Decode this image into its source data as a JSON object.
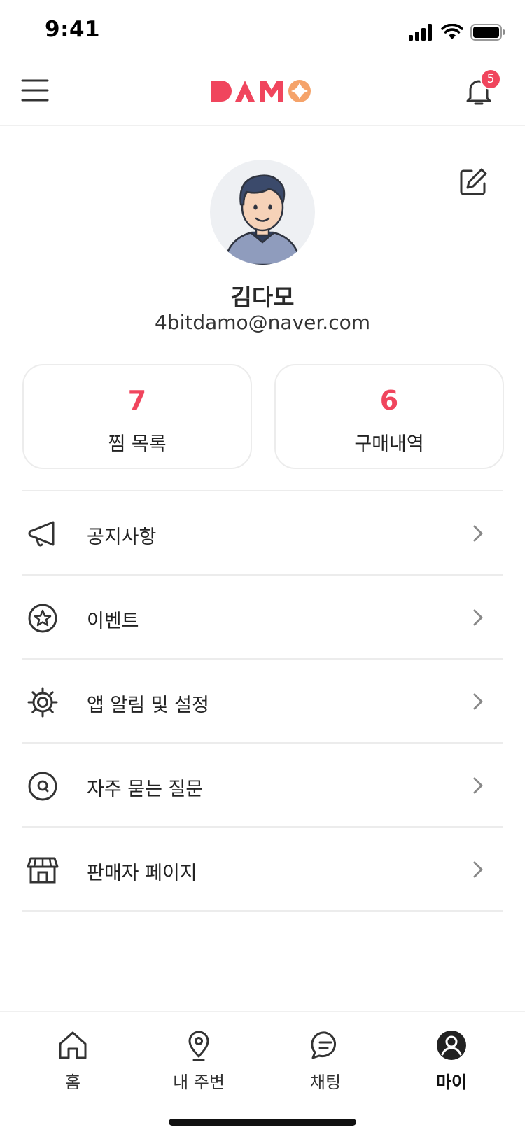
{
  "status_bar": {
    "time": "9:41",
    "icons": [
      "signal-icon",
      "wifi-icon",
      "battery-icon"
    ]
  },
  "header": {
    "logo_text": "DAMO",
    "notification_count": "5",
    "icons": [
      "hamburger-menu-icon",
      "bell-icon"
    ]
  },
  "profile": {
    "name": "김다모",
    "email": "4bitdamo@naver.com",
    "edit_icon": "edit-icon"
  },
  "stats": [
    {
      "value": "7",
      "label": "찜 목록"
    },
    {
      "value": "6",
      "label": "구매내역"
    }
  ],
  "menu": [
    {
      "label": "공지사항",
      "icon": "megaphone-icon"
    },
    {
      "label": "이벤트",
      "icon": "star-badge-icon"
    },
    {
      "label": "앱 알림 및 설정",
      "icon": "gear-icon"
    },
    {
      "label": "자주 묻는 질문",
      "icon": "faq-icon"
    },
    {
      "label": "판매자 페이지",
      "icon": "store-icon"
    }
  ],
  "tabs": [
    {
      "label": "홈",
      "icon": "home-icon",
      "active": false
    },
    {
      "label": "내 주변",
      "icon": "location-pin-icon",
      "active": false
    },
    {
      "label": "채팅",
      "icon": "chat-bubble-icon",
      "active": false
    },
    {
      "label": "마이",
      "icon": "user-profile-icon",
      "active": true
    }
  ],
  "colors": {
    "accent": "#f0455d",
    "logo_orange": "#f5a36a",
    "text": "#222222",
    "divider": "#ececec"
  }
}
